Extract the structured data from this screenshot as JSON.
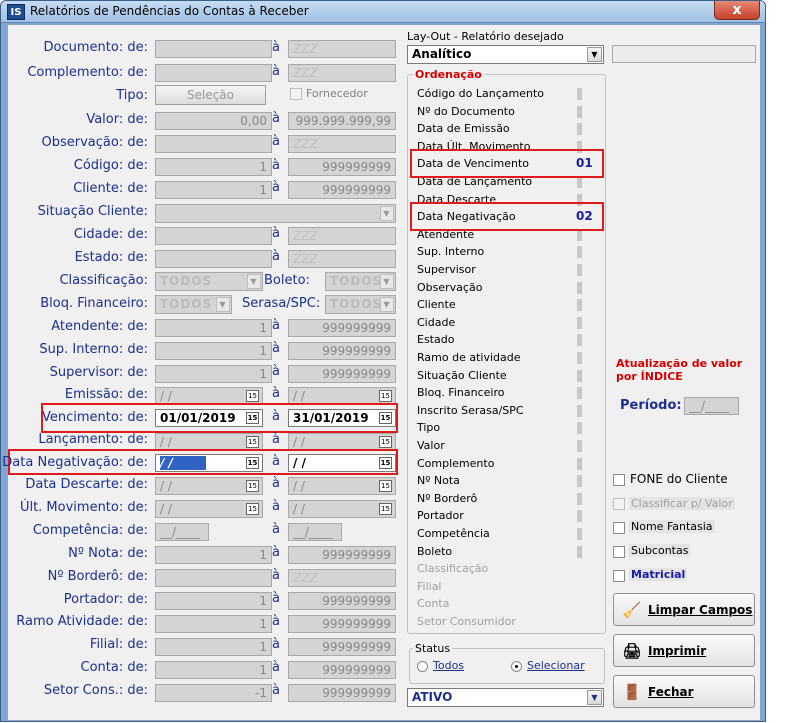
{
  "window": {
    "title": "Relatórios de Pendências do Contas à Receber",
    "icon_text": "IS",
    "close": "x"
  },
  "form": {
    "documento": {
      "label": "Documento: de:",
      "from": "",
      "to": "ZZZ"
    },
    "complemento": {
      "label": "Complemento: de:",
      "from": "",
      "to": "ZZZ"
    },
    "tipo": {
      "label": "Tipo:",
      "button": "Seleção",
      "fornecedor": "Fornecedor"
    },
    "valor": {
      "label": "Valor: de:",
      "from": "0,00",
      "to": "999.999.999,99"
    },
    "observacao": {
      "label": "Observação: de:",
      "from": "",
      "to": "ZZZ"
    },
    "codigo": {
      "label": "Código: de:",
      "from": "1",
      "to": "999999999"
    },
    "cliente": {
      "label": "Cliente: de:",
      "from": "1",
      "to": "999999999"
    },
    "situacao_cliente": {
      "label": "Situação Cliente:"
    },
    "cidade": {
      "label": "Cidade: de:",
      "from": "",
      "to": "ZZZ"
    },
    "estado": {
      "label": "Estado: de:",
      "from": "",
      "to": "ZZZ"
    },
    "classificacao": {
      "label": "Classificação:",
      "value": "TODOS"
    },
    "boleto": {
      "label": "Boleto:",
      "value": "TODOS"
    },
    "bloq_financeiro": {
      "label": "Bloq. Financeiro:",
      "value": "TODOS"
    },
    "serasa_spc": {
      "label": "Serasa/SPC:",
      "value": "TODOS"
    },
    "atendente": {
      "label": "Atendente: de:",
      "from": "1",
      "to": "999999999"
    },
    "sup_interno": {
      "label": "Sup. Interno: de:",
      "from": "1",
      "to": "999999999"
    },
    "supervisor": {
      "label": "Supervisor: de:",
      "from": "1",
      "to": "999999999"
    },
    "emissao": {
      "label": "Emissão: de:",
      "from": " /  /",
      "to": " /  /"
    },
    "vencimento": {
      "label": "Vencimento: de:",
      "from": "01/01/2019",
      "to": "31/01/2019"
    },
    "lancamento": {
      "label": "Lançamento: de:",
      "from": " /  /",
      "to": " /  /"
    },
    "data_negativacao": {
      "label": "Data Negativação: de:",
      "from": " /  /",
      "to": " /  /"
    },
    "data_descarte": {
      "label": "Data Descarte: de:",
      "from": " /  /",
      "to": " /  /"
    },
    "ult_movimento": {
      "label": "Últ. Movimento: de:",
      "from": " /  /",
      "to": " /  /"
    },
    "competencia": {
      "label": "Competência: de:",
      "from": "__/____",
      "to": "__/____"
    },
    "nota": {
      "label": "Nº Nota: de:",
      "from": "1",
      "to": "999999999"
    },
    "bordero": {
      "label": "Nº Borderô: de:",
      "from": "",
      "to": "ZZZ"
    },
    "portador": {
      "label": "Portador: de:",
      "from": "1",
      "to": "999999999"
    },
    "ramo_atividade": {
      "label": "Ramo Atividade: de:",
      "from": "1",
      "to": "999999999"
    },
    "filial": {
      "label": "Filial: de:",
      "from": "1",
      "to": "999999999"
    },
    "conta": {
      "label": "Conta: de:",
      "from": "1",
      "to": "999999999"
    },
    "setor_cons": {
      "label": "Setor Cons.: de:",
      "from": "-1",
      "to": "999999999"
    },
    "a": "à",
    "cal": "15"
  },
  "layout": {
    "label": "Lay-Out - Relatório desejado",
    "value": "Analítico"
  },
  "ordenacao": {
    "title": "Ordenação",
    "items": [
      {
        "label": "Código do Lançamento",
        "enabled": true,
        "order": ""
      },
      {
        "label": "Nº do Documento",
        "enabled": true,
        "order": ""
      },
      {
        "label": "Data de Emissão",
        "enabled": true,
        "order": ""
      },
      {
        "label": "Data Últ. Movimento",
        "enabled": true,
        "order": ""
      },
      {
        "label": "Data de Vencimento",
        "enabled": true,
        "order": "01"
      },
      {
        "label": "Data de Lançamento",
        "enabled": true,
        "order": ""
      },
      {
        "label": "Data Descarte",
        "enabled": true,
        "order": ""
      },
      {
        "label": "Data Negativação",
        "enabled": true,
        "order": "02"
      },
      {
        "label": "Atendente",
        "enabled": true,
        "order": ""
      },
      {
        "label": "Sup. Interno",
        "enabled": true,
        "order": ""
      },
      {
        "label": "Supervisor",
        "enabled": true,
        "order": ""
      },
      {
        "label": "Observação",
        "enabled": true,
        "order": ""
      },
      {
        "label": "Cliente",
        "enabled": true,
        "order": ""
      },
      {
        "label": "Cidade",
        "enabled": true,
        "order": ""
      },
      {
        "label": "Estado",
        "enabled": true,
        "order": ""
      },
      {
        "label": "Ramo de atividade",
        "enabled": true,
        "order": ""
      },
      {
        "label": "Situação Cliente",
        "enabled": true,
        "order": ""
      },
      {
        "label": "Bloq. Financeiro",
        "enabled": true,
        "order": ""
      },
      {
        "label": "Inscrito Serasa/SPC",
        "enabled": true,
        "order": ""
      },
      {
        "label": "Tipo",
        "enabled": true,
        "order": ""
      },
      {
        "label": "Valor",
        "enabled": true,
        "order": ""
      },
      {
        "label": "Complemento",
        "enabled": true,
        "order": ""
      },
      {
        "label": "Nº Nota",
        "enabled": true,
        "order": ""
      },
      {
        "label": "Nº Borderô",
        "enabled": true,
        "order": ""
      },
      {
        "label": "Portador",
        "enabled": true,
        "order": ""
      },
      {
        "label": "Competência",
        "enabled": true,
        "order": ""
      },
      {
        "label": "Boleto",
        "enabled": true,
        "order": ""
      },
      {
        "label": "Classificação",
        "enabled": false,
        "order": ""
      },
      {
        "label": "Filial",
        "enabled": false,
        "order": ""
      },
      {
        "label": "Conta",
        "enabled": false,
        "order": ""
      },
      {
        "label": "Setor Consumidor",
        "enabled": false,
        "order": ""
      }
    ]
  },
  "status": {
    "title": "Status",
    "todos": "Todos",
    "selecionar": "Selecionar",
    "selected": "selecionar",
    "combo": "ATIVO"
  },
  "atualizacao": {
    "line1": "Atualização de valor",
    "line2": "por ÍNDICE",
    "periodo_label": "Período:",
    "periodo_value": "__/____"
  },
  "options": {
    "fone_cliente": "FONE do Cliente",
    "classificar_valor": "Classificar p/ Valor",
    "nome_fantasia": "Nome Fantasia",
    "subcontas": "Subcontas",
    "matricial": "Matricial"
  },
  "buttons": {
    "limpar": "Limpar Campos",
    "imprimir": "Imprimir",
    "fechar": "Fechar"
  },
  "colors": {
    "label_blue": "#1c2f8c",
    "highlight_red": "#e01b1b",
    "order_num": "#1a1aa8",
    "title_red": "#d60000"
  }
}
